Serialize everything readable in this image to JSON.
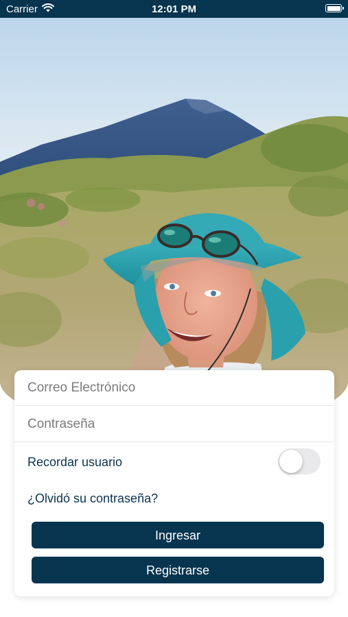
{
  "status_bar": {
    "carrier": "Carrier",
    "time": "12:01 PM",
    "icons": [
      "wifi-icon",
      "battery-icon"
    ]
  },
  "hero": {
    "image": "hero-photo-hiker"
  },
  "login": {
    "email_placeholder": "Correo Electrónico",
    "email_value": "",
    "password_placeholder": "Contraseña",
    "password_value": "",
    "remember_label": "Recordar usuario",
    "remember_on": false,
    "forgot_link": "¿Olvidó su contraseña?",
    "login_button": "Ingresar",
    "register_button": "Registrarse"
  },
  "colors": {
    "primary": "#07344f",
    "text_dark": "#0b3350",
    "placeholder": "#7b7b7b",
    "toggle_off": "#e9e9eb"
  }
}
